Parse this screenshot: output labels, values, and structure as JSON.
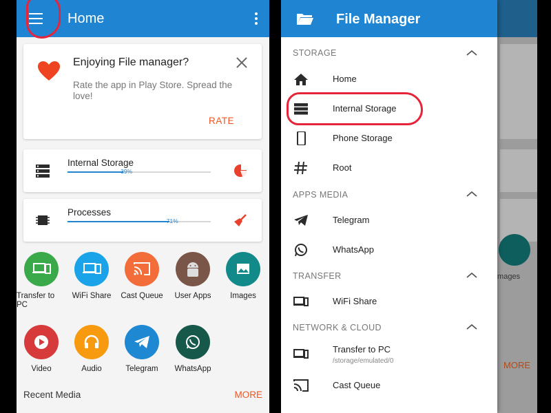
{
  "left_screen": {
    "appbar": {
      "title": "Home"
    },
    "rate_card": {
      "title": "Enjoying File manager?",
      "text": "Rate the app in Play Store. Spread the love!",
      "button": "RATE"
    },
    "storage_cards": [
      {
        "label": "Internal Storage",
        "percent_text": "39%",
        "progress": 0.39
      },
      {
        "label": "Processes",
        "percent_text": "71%",
        "progress": 0.71
      }
    ],
    "shortcuts": [
      {
        "label": "Transfer to PC",
        "color": "#3aa94a",
        "icon": "transfer-pc-icon"
      },
      {
        "label": "WiFi Share",
        "color": "#1aa3e8",
        "icon": "wifi-share-icon"
      },
      {
        "label": "Cast Queue",
        "color": "#f26d3a",
        "icon": "cast-icon"
      },
      {
        "label": "User Apps",
        "color": "#7a5648",
        "icon": "android-icon"
      },
      {
        "label": "Images",
        "color": "#138a8a",
        "icon": "image-icon"
      },
      {
        "label": "Video",
        "color": "#d63a3a",
        "icon": "play-icon"
      },
      {
        "label": "Audio",
        "color": "#f79a10",
        "icon": "headphones-icon"
      },
      {
        "label": "Telegram",
        "color": "#1e88d2",
        "icon": "telegram-icon"
      },
      {
        "label": "WhatsApp",
        "color": "#16584a",
        "icon": "whatsapp-icon"
      }
    ],
    "recent": {
      "title": "Recent Media",
      "more": "MORE"
    }
  },
  "right_screen": {
    "drawer": {
      "title": "File Manager",
      "sections": [
        {
          "header": "STORAGE",
          "items": [
            {
              "label": "Home",
              "icon": "home-icon"
            },
            {
              "label": "Internal Storage",
              "icon": "storage-icon"
            },
            {
              "label": "Phone Storage",
              "icon": "phone-icon"
            },
            {
              "label": "Root",
              "icon": "hash-icon"
            }
          ]
        },
        {
          "header": "APPS MEDIA",
          "items": [
            {
              "label": "Telegram",
              "icon": "telegram-icon"
            },
            {
              "label": "WhatsApp",
              "icon": "whatsapp-icon"
            }
          ]
        },
        {
          "header": "TRANSFER",
          "items": [
            {
              "label": "WiFi Share",
              "icon": "wifi-share-icon"
            }
          ]
        },
        {
          "header": "NETWORK & CLOUD",
          "items": [
            {
              "label": "Transfer to PC",
              "sub": "/storage/emulated/0",
              "icon": "transfer-pc-icon"
            },
            {
              "label": "Cast Queue",
              "icon": "cast-icon"
            }
          ]
        }
      ]
    },
    "behind": {
      "images_label": "Images",
      "more": "MORE"
    }
  }
}
